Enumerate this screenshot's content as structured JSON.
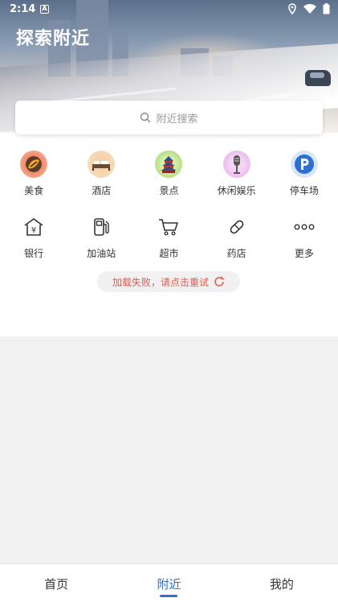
{
  "status_bar": {
    "time": "2:14",
    "app_glyph": "A",
    "icons": [
      "location-icon",
      "wifi-icon",
      "battery-icon"
    ]
  },
  "header": {
    "title": "探索附近"
  },
  "search": {
    "placeholder": "附近搜索",
    "icon": "search-icon"
  },
  "categories_row1": [
    {
      "label": "美食",
      "icon": "food-icon"
    },
    {
      "label": "酒店",
      "icon": "hotel-icon"
    },
    {
      "label": "景点",
      "icon": "scenic-icon"
    },
    {
      "label": "休闲娱乐",
      "icon": "entertainment-icon"
    },
    {
      "label": "停车场",
      "icon": "parking-icon"
    }
  ],
  "categories_row2": [
    {
      "label": "银行",
      "icon": "bank-icon"
    },
    {
      "label": "加油站",
      "icon": "gas-station-icon"
    },
    {
      "label": "超市",
      "icon": "cart-icon"
    },
    {
      "label": "药店",
      "icon": "pill-icon"
    },
    {
      "label": "更多",
      "icon": "more-icon"
    }
  ],
  "retry": {
    "text": "加载失败，请点击重试",
    "icon": "refresh-icon",
    "color": "#e05a4f"
  },
  "bottom_nav": {
    "tabs": [
      {
        "label": "首页"
      },
      {
        "label": "附近",
        "active": true
      },
      {
        "label": "我的"
      }
    ],
    "accent": "#2d6fd6"
  }
}
